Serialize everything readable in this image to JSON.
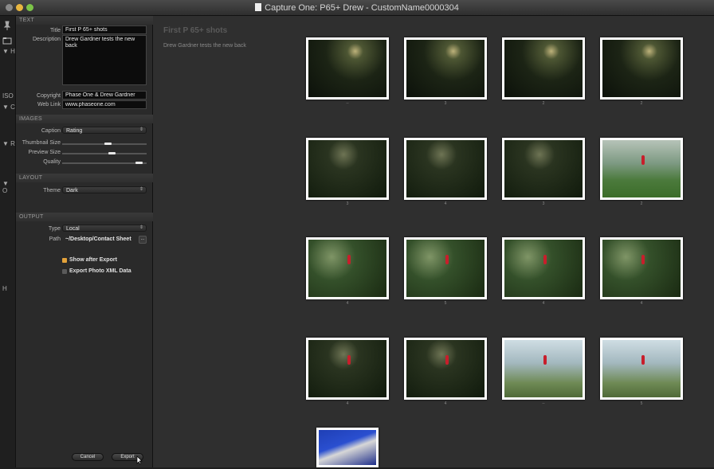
{
  "window": {
    "title": "Capture One: P65+ Drew - CustomName0000304"
  },
  "toolstrip": {
    "labels": [
      "ISO",
      "H",
      "C",
      "R",
      "O",
      "H"
    ]
  },
  "sections": {
    "text": "TEXT",
    "images": "IMAGES",
    "layout": "LAYOUT",
    "output": "OUTPUT"
  },
  "text": {
    "title_label": "Title",
    "title_value": "First P 65+ shots",
    "description_label": "Description",
    "description_value": "Drew Gardner tests the new back",
    "copyright_label": "Copyright",
    "copyright_value": "Phase One & Drew Gardner",
    "weblink_label": "Web Link",
    "weblink_value": "www.phaseone.com"
  },
  "images": {
    "caption_label": "Caption",
    "caption_value": "Rating",
    "thumbnail_label": "Thumbnail Size",
    "thumbnail_level": 0.55,
    "preview_label": "Preview Size",
    "preview_level": 0.6,
    "quality_label": "Quality",
    "quality_level": 0.95
  },
  "layout": {
    "theme_label": "Theme",
    "theme_value": "Dark"
  },
  "output": {
    "type_label": "Type",
    "type_value": "Local",
    "path_label": "Path",
    "path_value": "~/Desktop/Contact Sheet",
    "browse_label": "...",
    "show_after_export_label": "Show after Export",
    "show_after_export_checked": true,
    "export_xml_label": "Export Photo XML Data",
    "export_xml_checked": false
  },
  "buttons": {
    "cancel": "Cancel",
    "export": "Export"
  },
  "preview": {
    "title": "First P 65+ shots",
    "description": "Drew Gardner tests the new back",
    "thumbnails": [
      {
        "caption": "--",
        "style": "img-forest"
      },
      {
        "caption": "3",
        "style": "img-forest"
      },
      {
        "caption": "2",
        "style": "img-forest"
      },
      {
        "caption": "2",
        "style": "img-forest"
      },
      {
        "caption": "3",
        "style": "img-forest2"
      },
      {
        "caption": "4",
        "style": "img-forest2"
      },
      {
        "caption": "3",
        "style": "img-forest2"
      },
      {
        "caption": "2",
        "style": "img-bright"
      },
      {
        "caption": "4",
        "style": "img-green"
      },
      {
        "caption": "5",
        "style": "img-green"
      },
      {
        "caption": "4",
        "style": "img-green"
      },
      {
        "caption": "4",
        "style": "img-green"
      },
      {
        "caption": "4",
        "style": "img-forest2"
      },
      {
        "caption": "4",
        "style": "img-forest2"
      },
      {
        "caption": "--",
        "style": "img-light"
      },
      {
        "caption": "5",
        "style": "img-light"
      },
      {
        "caption": "",
        "style": "img-blue"
      }
    ]
  }
}
